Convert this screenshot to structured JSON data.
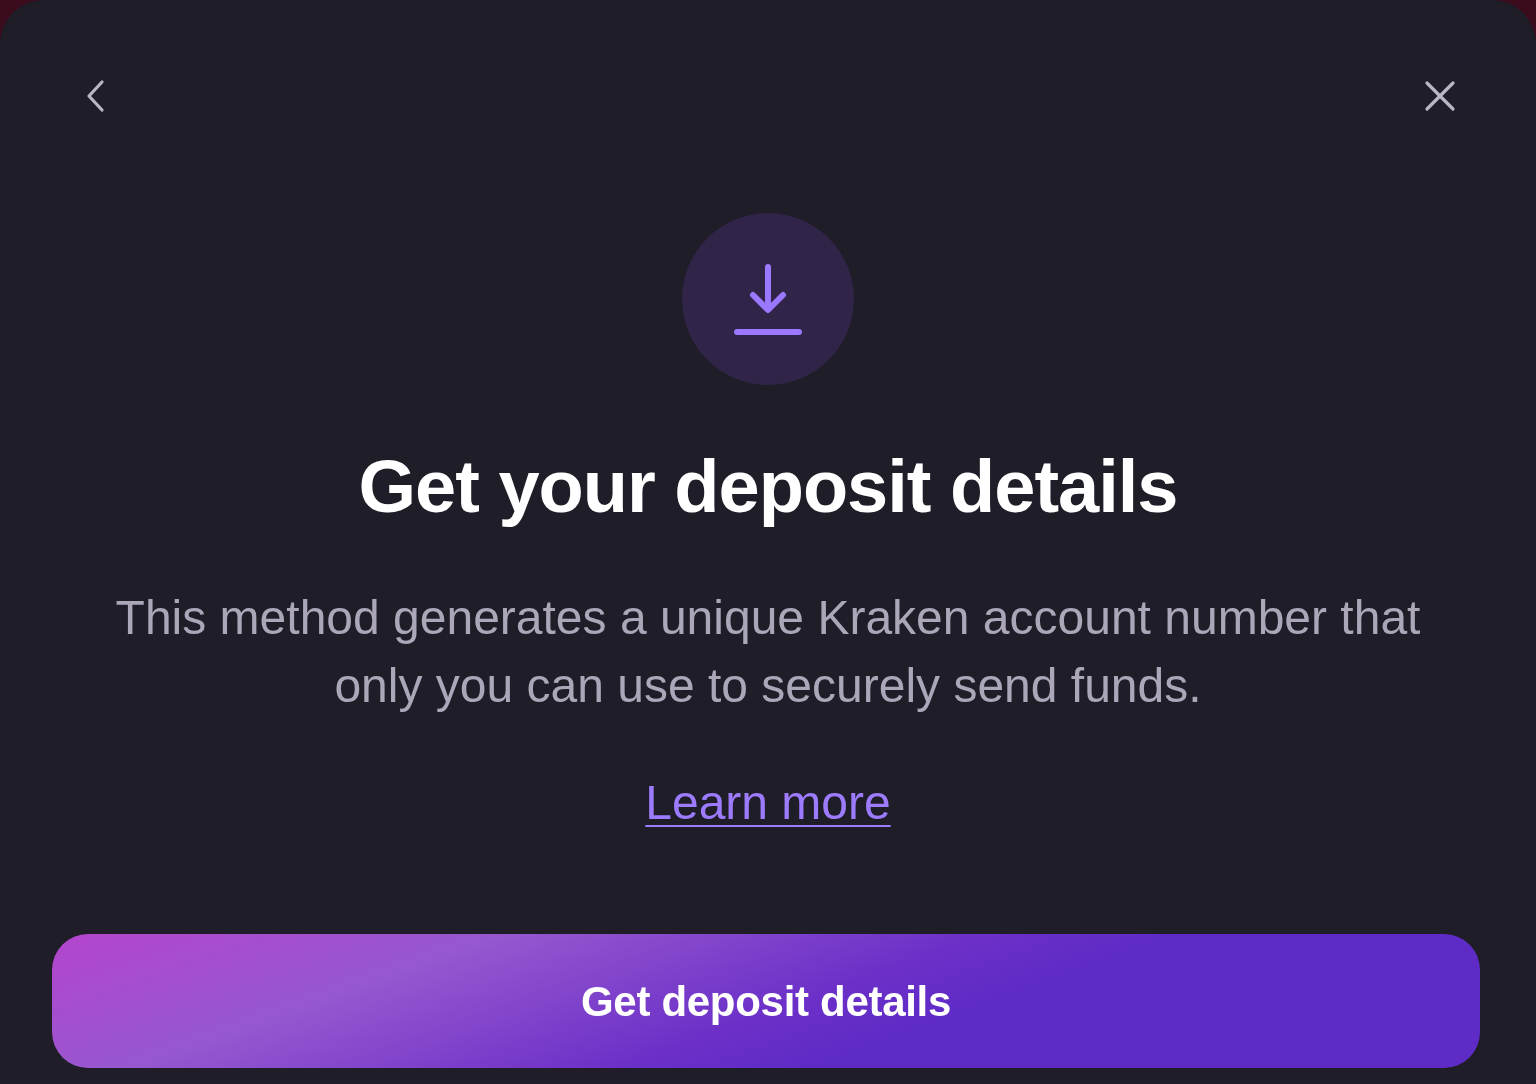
{
  "dialog": {
    "title": "Get your deposit details",
    "description": "This method generates a unique Kraken account number that only you can use to securely send funds.",
    "link": "Learn more",
    "primary_button": "Get deposit details"
  }
}
